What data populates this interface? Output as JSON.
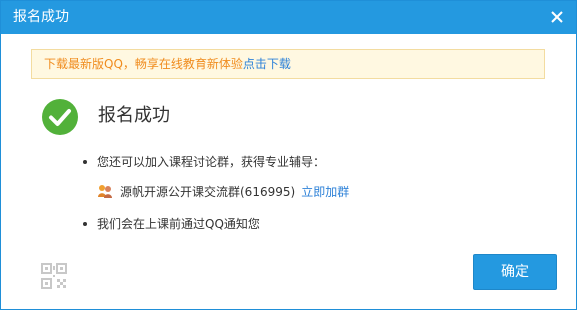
{
  "dialog": {
    "title": "报名成功",
    "close_icon": "close-icon"
  },
  "notice": {
    "text": "下载最新版QQ，畅享在线教育新体验",
    "link": "点击下载"
  },
  "result": {
    "icon": "check-circle-icon",
    "heading": "报名成功"
  },
  "info": {
    "item1": "您还可以加入课程讨论群，获得专业辅导：",
    "group_icon": "group-icon",
    "group_name": "源帆开源公开课交流群(616995)",
    "join_link": "立即加群",
    "item2": "我们会在上课前通过QQ通知您"
  },
  "footer": {
    "qr_icon": "qr-code-icon",
    "confirm_label": "确定"
  },
  "colors": {
    "accent": "#2499e0",
    "success": "#52b13a",
    "notice_text": "#f08c1e",
    "link": "#2e82d8"
  }
}
